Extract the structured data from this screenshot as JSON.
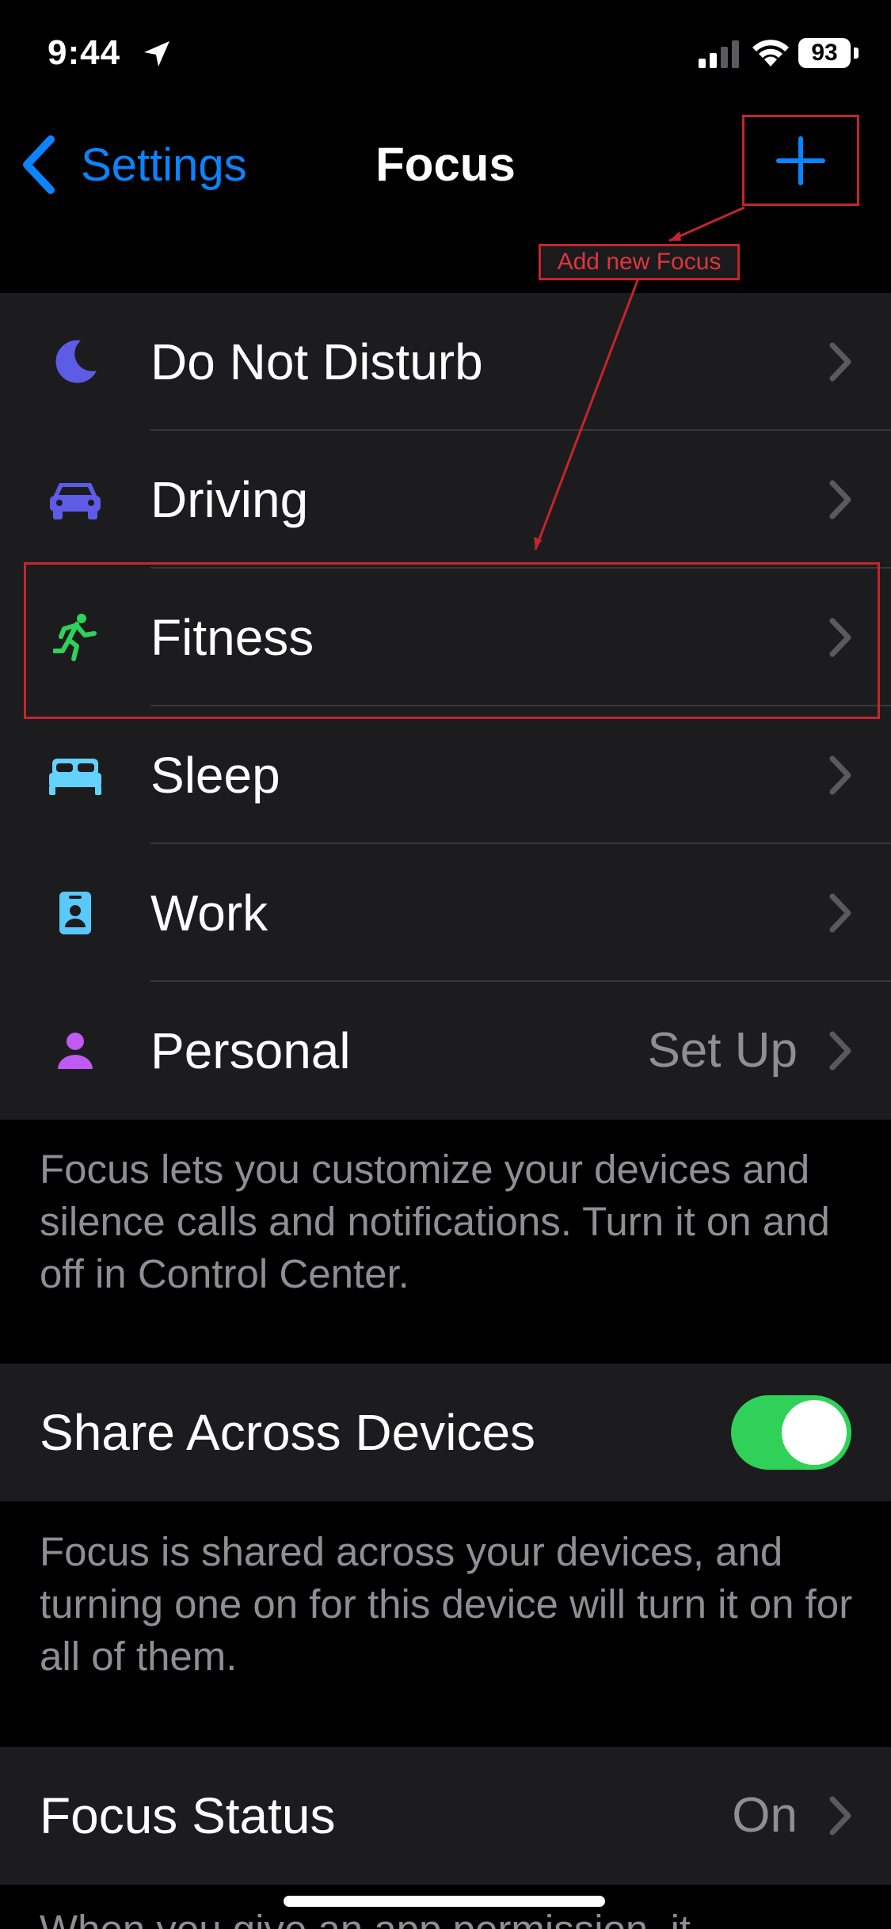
{
  "status_bar": {
    "time": "9:44",
    "battery": "93",
    "icons": [
      "location-arrow-icon",
      "cellular-signal-icon",
      "wifi-icon",
      "battery-icon"
    ]
  },
  "nav": {
    "back_label": "Settings",
    "title": "Focus",
    "add_icon": "plus-icon",
    "accent_color": "#0a84ff"
  },
  "annotation": {
    "label": "Add new Focus",
    "color": "#c4252c"
  },
  "focus_modes": [
    {
      "label": "Do Not Disturb",
      "icon": "moon-icon",
      "color": "#5e5ce6",
      "value": ""
    },
    {
      "label": "Driving",
      "icon": "car-icon",
      "color": "#5e5ce6",
      "value": ""
    },
    {
      "label": "Fitness",
      "icon": "running-figure-icon",
      "color": "#30d158",
      "value": ""
    },
    {
      "label": "Sleep",
      "icon": "bed-icon",
      "color": "#64d2ff",
      "value": ""
    },
    {
      "label": "Work",
      "icon": "id-badge-icon",
      "color": "#5ac8fa",
      "value": ""
    },
    {
      "label": "Personal",
      "icon": "person-icon",
      "color": "#bf5af2",
      "value": "Set Up"
    }
  ],
  "focus_footnote": "Focus lets you customize your devices and silence calls and notifications. Turn it on and off in Control Center.",
  "share": {
    "label": "Share Across Devices",
    "enabled": true,
    "footnote": "Focus is shared across your devices, and turning one on for this device will turn it on for all of them."
  },
  "focus_status": {
    "label": "Focus Status",
    "value": "On",
    "footnote_partial": "When you give an app permission, it"
  }
}
